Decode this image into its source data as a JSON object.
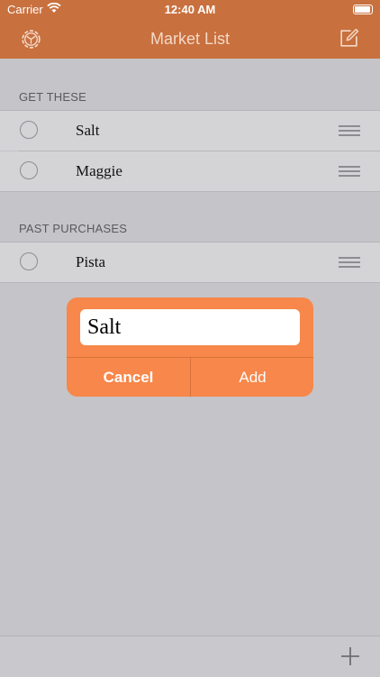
{
  "status_bar": {
    "carrier": "Carrier",
    "time": "12:40 AM"
  },
  "nav": {
    "title": "Market List",
    "left_icon": "gear-icon",
    "right_icon": "compose-icon"
  },
  "sections": [
    {
      "header": "GET THESE",
      "items": [
        {
          "label": "Salt"
        },
        {
          "label": "Maggie"
        }
      ]
    },
    {
      "header": "PAST PURCHASES",
      "items": [
        {
          "label": "Pista"
        }
      ]
    }
  ],
  "dialog": {
    "input_value": "Salt",
    "cancel_label": "Cancel",
    "add_label": "Add"
  },
  "toolbar": {
    "add_icon": "plus-icon"
  },
  "colors": {
    "accent": "#c8703e",
    "dialog": "#f7874a",
    "background": "#c5c4c8"
  }
}
